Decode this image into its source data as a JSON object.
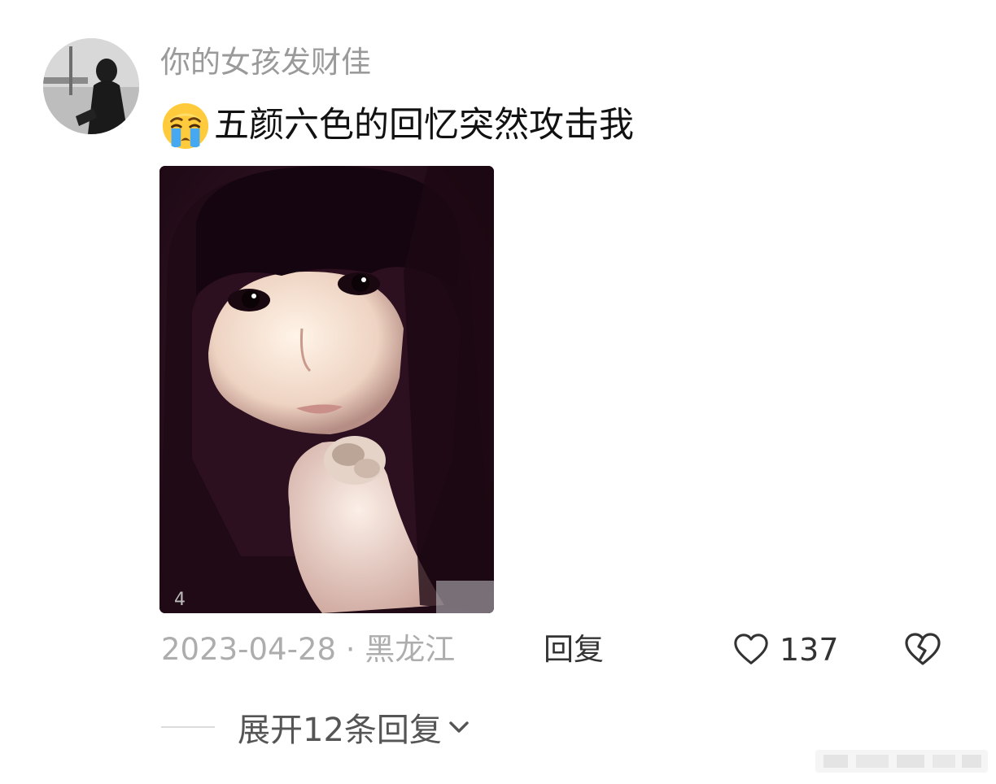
{
  "comment": {
    "username": "你的女孩发财佳",
    "emoji": "loudly-crying-face-emoji",
    "text": "五颜六色的回忆突然攻击我",
    "date": "2023-04-28",
    "separator": "·",
    "location": "黑龙江",
    "meta_text": "2023-04-28 · 黑龙江",
    "reply_label": "回复",
    "like_count": "137",
    "expand_label": "展开12条回复"
  },
  "icons": {
    "like": "heart-outline-icon",
    "dislike": "broken-heart-icon",
    "expand": "chevron-down-icon"
  },
  "colors": {
    "username": "#9a9a9a",
    "text": "#111111",
    "meta": "#adadad",
    "action": "#333333",
    "photo_bg": "#2a0f1e"
  }
}
